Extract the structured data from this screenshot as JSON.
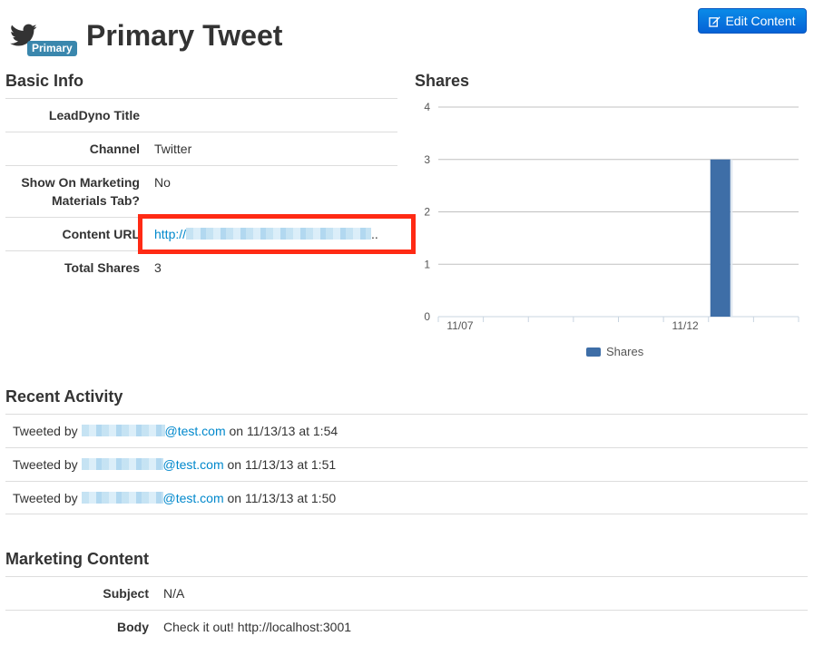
{
  "header": {
    "title": "Primary Tweet",
    "badge": "Primary",
    "icon": "twitter-bird-icon",
    "edit_button": "Edit Content"
  },
  "basic_info": {
    "title": "Basic Info",
    "rows": [
      {
        "label": "LeadDyno Title",
        "value": ""
      },
      {
        "label": "Channel",
        "value": "Twitter"
      },
      {
        "label": "Show On Marketing Materials Tab?",
        "value": "No"
      },
      {
        "label": "Content URL",
        "value": "http://",
        "suffix": ".."
      },
      {
        "label": "Total Shares",
        "value": "3"
      }
    ]
  },
  "chart_data": {
    "type": "bar",
    "title": "Shares",
    "ylim": [
      0,
      4
    ],
    "y_ticks": [
      0,
      1,
      2,
      3,
      4
    ],
    "x_tick_labels": [
      "11/07",
      "11/12"
    ],
    "series": [
      {
        "name": "Shares",
        "categories": [
          "11/13"
        ],
        "values": [
          3
        ]
      }
    ],
    "legend": "bottom",
    "grid": true,
    "colors": {
      "bar": "#3e6ea7"
    }
  },
  "recent_activity": {
    "title": "Recent Activity",
    "items": [
      {
        "prefix": "Tweeted by",
        "email_domain": "@test.com",
        "suffix": "on 11/13/13 at 1:54"
      },
      {
        "prefix": "Tweeted by",
        "email_domain": "@test.com",
        "suffix": "on 11/13/13 at 1:51"
      },
      {
        "prefix": "Tweeted by",
        "email_domain": "@test.com",
        "suffix": "on 11/13/13 at 1:50"
      }
    ]
  },
  "marketing_content": {
    "title": "Marketing Content",
    "rows": [
      {
        "label": "Subject",
        "value": "N/A"
      },
      {
        "label": "Body",
        "value": "Check it out! http://localhost:3001"
      }
    ]
  },
  "colors": {
    "accent": "#0088cc",
    "button": "#0562d6",
    "badge": "#3a87ad",
    "highlight": "#ff2a14"
  }
}
